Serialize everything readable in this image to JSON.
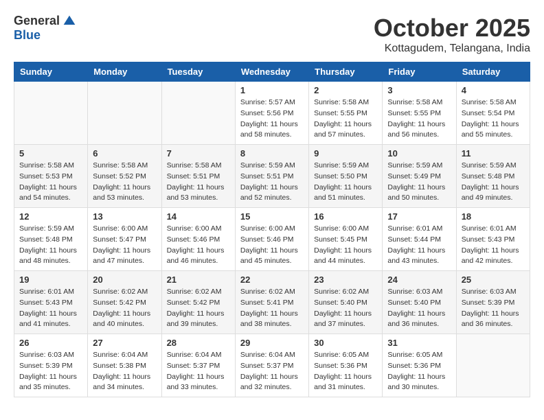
{
  "logo": {
    "general": "General",
    "blue": "Blue"
  },
  "title": "October 2025",
  "location": "Kottagudem, Telangana, India",
  "headers": [
    "Sunday",
    "Monday",
    "Tuesday",
    "Wednesday",
    "Thursday",
    "Friday",
    "Saturday"
  ],
  "weeks": [
    [
      {
        "day": "",
        "info": ""
      },
      {
        "day": "",
        "info": ""
      },
      {
        "day": "",
        "info": ""
      },
      {
        "day": "1",
        "info": "Sunrise: 5:57 AM\nSunset: 5:56 PM\nDaylight: 11 hours\nand 58 minutes."
      },
      {
        "day": "2",
        "info": "Sunrise: 5:58 AM\nSunset: 5:55 PM\nDaylight: 11 hours\nand 57 minutes."
      },
      {
        "day": "3",
        "info": "Sunrise: 5:58 AM\nSunset: 5:55 PM\nDaylight: 11 hours\nand 56 minutes."
      },
      {
        "day": "4",
        "info": "Sunrise: 5:58 AM\nSunset: 5:54 PM\nDaylight: 11 hours\nand 55 minutes."
      }
    ],
    [
      {
        "day": "5",
        "info": "Sunrise: 5:58 AM\nSunset: 5:53 PM\nDaylight: 11 hours\nand 54 minutes."
      },
      {
        "day": "6",
        "info": "Sunrise: 5:58 AM\nSunset: 5:52 PM\nDaylight: 11 hours\nand 53 minutes."
      },
      {
        "day": "7",
        "info": "Sunrise: 5:58 AM\nSunset: 5:51 PM\nDaylight: 11 hours\nand 53 minutes."
      },
      {
        "day": "8",
        "info": "Sunrise: 5:59 AM\nSunset: 5:51 PM\nDaylight: 11 hours\nand 52 minutes."
      },
      {
        "day": "9",
        "info": "Sunrise: 5:59 AM\nSunset: 5:50 PM\nDaylight: 11 hours\nand 51 minutes."
      },
      {
        "day": "10",
        "info": "Sunrise: 5:59 AM\nSunset: 5:49 PM\nDaylight: 11 hours\nand 50 minutes."
      },
      {
        "day": "11",
        "info": "Sunrise: 5:59 AM\nSunset: 5:48 PM\nDaylight: 11 hours\nand 49 minutes."
      }
    ],
    [
      {
        "day": "12",
        "info": "Sunrise: 5:59 AM\nSunset: 5:48 PM\nDaylight: 11 hours\nand 48 minutes."
      },
      {
        "day": "13",
        "info": "Sunrise: 6:00 AM\nSunset: 5:47 PM\nDaylight: 11 hours\nand 47 minutes."
      },
      {
        "day": "14",
        "info": "Sunrise: 6:00 AM\nSunset: 5:46 PM\nDaylight: 11 hours\nand 46 minutes."
      },
      {
        "day": "15",
        "info": "Sunrise: 6:00 AM\nSunset: 5:46 PM\nDaylight: 11 hours\nand 45 minutes."
      },
      {
        "day": "16",
        "info": "Sunrise: 6:00 AM\nSunset: 5:45 PM\nDaylight: 11 hours\nand 44 minutes."
      },
      {
        "day": "17",
        "info": "Sunrise: 6:01 AM\nSunset: 5:44 PM\nDaylight: 11 hours\nand 43 minutes."
      },
      {
        "day": "18",
        "info": "Sunrise: 6:01 AM\nSunset: 5:43 PM\nDaylight: 11 hours\nand 42 minutes."
      }
    ],
    [
      {
        "day": "19",
        "info": "Sunrise: 6:01 AM\nSunset: 5:43 PM\nDaylight: 11 hours\nand 41 minutes."
      },
      {
        "day": "20",
        "info": "Sunrise: 6:02 AM\nSunset: 5:42 PM\nDaylight: 11 hours\nand 40 minutes."
      },
      {
        "day": "21",
        "info": "Sunrise: 6:02 AM\nSunset: 5:42 PM\nDaylight: 11 hours\nand 39 minutes."
      },
      {
        "day": "22",
        "info": "Sunrise: 6:02 AM\nSunset: 5:41 PM\nDaylight: 11 hours\nand 38 minutes."
      },
      {
        "day": "23",
        "info": "Sunrise: 6:02 AM\nSunset: 5:40 PM\nDaylight: 11 hours\nand 37 minutes."
      },
      {
        "day": "24",
        "info": "Sunrise: 6:03 AM\nSunset: 5:40 PM\nDaylight: 11 hours\nand 36 minutes."
      },
      {
        "day": "25",
        "info": "Sunrise: 6:03 AM\nSunset: 5:39 PM\nDaylight: 11 hours\nand 36 minutes."
      }
    ],
    [
      {
        "day": "26",
        "info": "Sunrise: 6:03 AM\nSunset: 5:39 PM\nDaylight: 11 hours\nand 35 minutes."
      },
      {
        "day": "27",
        "info": "Sunrise: 6:04 AM\nSunset: 5:38 PM\nDaylight: 11 hours\nand 34 minutes."
      },
      {
        "day": "28",
        "info": "Sunrise: 6:04 AM\nSunset: 5:37 PM\nDaylight: 11 hours\nand 33 minutes."
      },
      {
        "day": "29",
        "info": "Sunrise: 6:04 AM\nSunset: 5:37 PM\nDaylight: 11 hours\nand 32 minutes."
      },
      {
        "day": "30",
        "info": "Sunrise: 6:05 AM\nSunset: 5:36 PM\nDaylight: 11 hours\nand 31 minutes."
      },
      {
        "day": "31",
        "info": "Sunrise: 6:05 AM\nSunset: 5:36 PM\nDaylight: 11 hours\nand 30 minutes."
      },
      {
        "day": "",
        "info": ""
      }
    ]
  ]
}
